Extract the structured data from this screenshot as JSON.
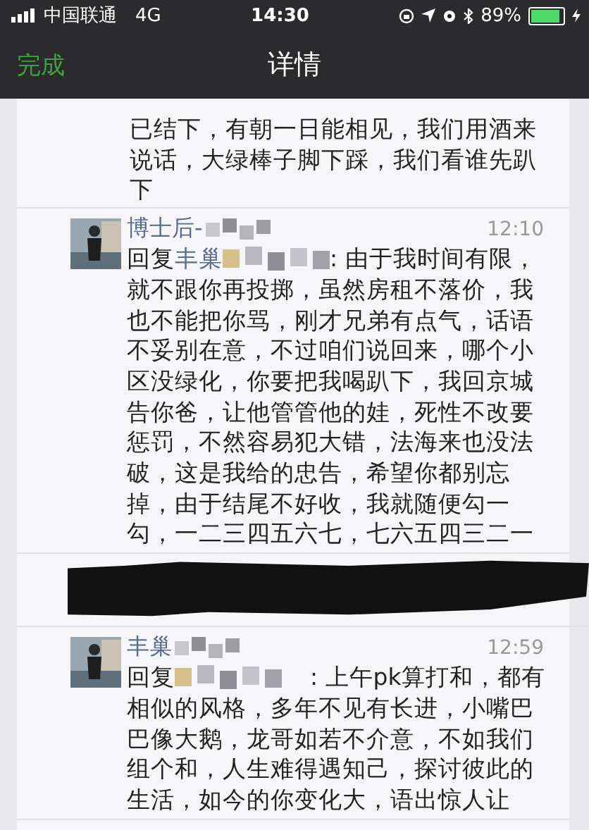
{
  "status_bar": {
    "carrier": "中国联通",
    "network": "4G",
    "time": "14:30",
    "battery": "89%"
  },
  "nav_bar": {
    "back": "完成",
    "title": "详情"
  },
  "comments": [
    {
      "kind": "continuation",
      "text": "已结下，有朝一日能相见，我们用酒来说话，大绿棒子脚下踩，我们看谁先趴下"
    },
    {
      "kind": "comment",
      "author": "博士后-",
      "author_redacted": true,
      "time": "12:10",
      "reply_prefix": "回复",
      "reply_to": "丰巢",
      "reply_redacted": true,
      "text": ": 由于我时间有限，就不跟你再投掷，虽然房租不落价，我也不能把你骂，刚才兄弟有点气，话语不妥别在意，不过咱们说回来，哪个小区没绿化，你要把我喝趴下，我回京城告你爸，让他管管他的娃，死性不改要惩罚，不然容易犯大错，法海来也没法破，这是我给的忠告，希望你都别忘掉，由于结尾不好收，我就随便勾一勾，一二三四五六七，七六五四三二一"
    },
    {
      "kind": "redacted"
    },
    {
      "kind": "comment",
      "author": "丰巢",
      "author_redacted": true,
      "time": "12:59",
      "reply_prefix": "回复",
      "reply_redacted": true,
      "text": ": 上午pk算打和，都有相似的风格，多年不见有长进，小嘴巴巴像大鹅，龙哥如若不介意，不如我们组个和，人生难得遇知己，探讨彼此的生活，如今的你变化大，语出惊人让"
    }
  ]
}
